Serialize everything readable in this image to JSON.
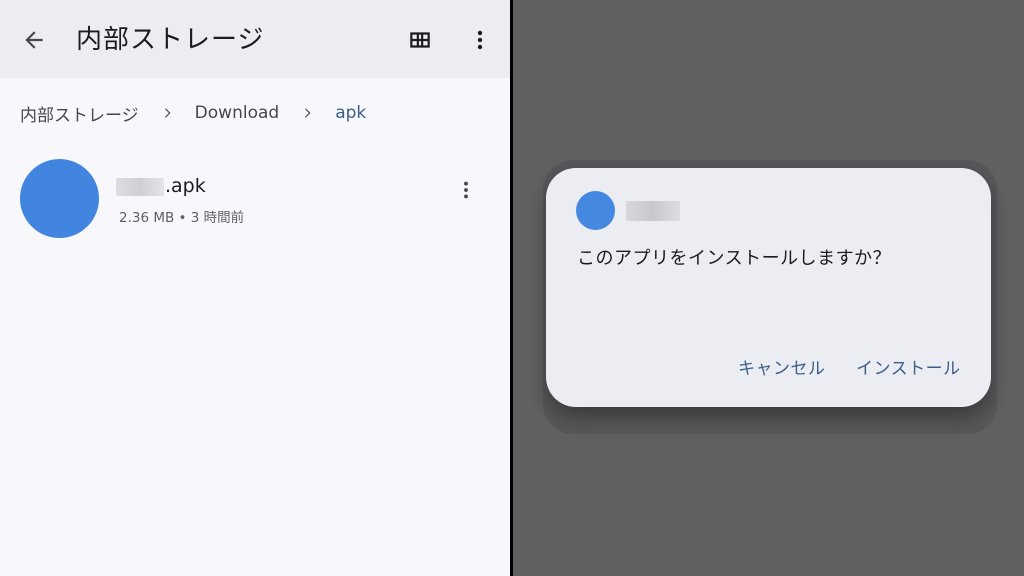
{
  "file_browser": {
    "title": "内部ストレージ",
    "breadcrumb": [
      "内部ストレージ",
      "Download",
      "apk"
    ],
    "files": [
      {
        "name": ".apk",
        "meta": "2.36 MB • 3 時間前"
      }
    ],
    "icons": {
      "back": "arrow-back-icon",
      "grid": "grid-view-icon",
      "menu": "more-vert-icon"
    }
  },
  "install_dialog": {
    "message": "このアプリをインストールしますか？",
    "cancel_label": "キャンセル",
    "install_label": "インストール"
  },
  "colors": {
    "accent": "#3a5f8a",
    "app_icon": "#4285e0",
    "overlay": "#616164",
    "dialog_bg": "#ececf3"
  }
}
